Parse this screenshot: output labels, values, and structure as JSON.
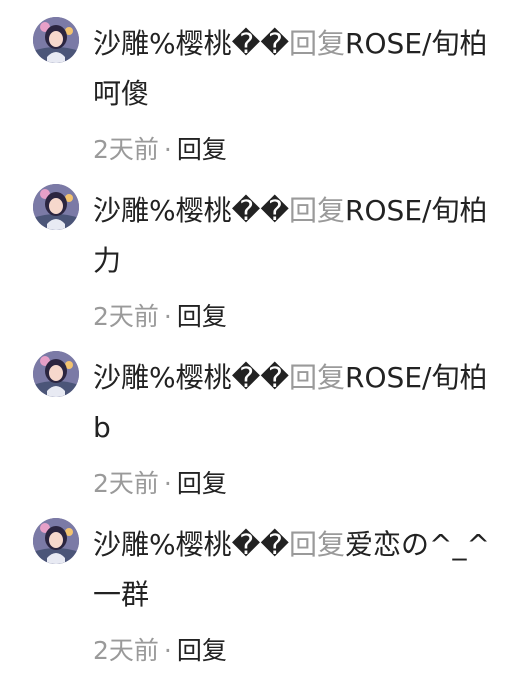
{
  "comments": [
    {
      "username": "沙雕%樱桃��",
      "reply_label": "回复",
      "reply_to": "ROSE/旬柏",
      "text": "呵傻",
      "time": "2天前",
      "separator": "·",
      "reply_button": "回复"
    },
    {
      "username": "沙雕%樱桃��",
      "reply_label": "回复",
      "reply_to": "ROSE/旬柏",
      "text": "力",
      "time": "2天前",
      "separator": "·",
      "reply_button": "回复"
    },
    {
      "username": "沙雕%樱桃��",
      "reply_label": "回复",
      "reply_to": "ROSE/旬柏",
      "text": "b",
      "time": "2天前",
      "separator": "·",
      "reply_button": "回复"
    },
    {
      "username": "沙雕%樱桃��",
      "reply_label": "回复",
      "reply_to": "爱恋の^_^",
      "text": "一群",
      "time": "2天前",
      "separator": "·",
      "reply_button": "回复"
    }
  ]
}
